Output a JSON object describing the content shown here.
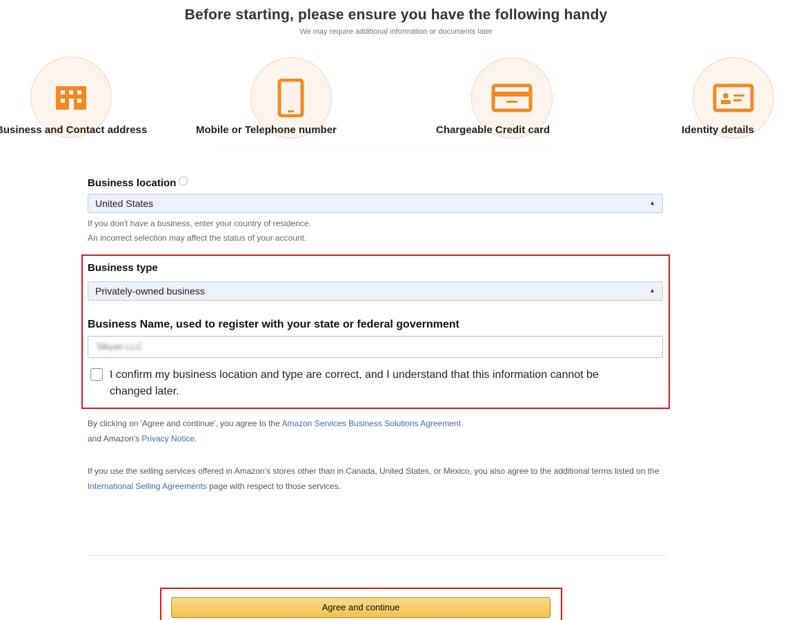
{
  "header": {
    "title": "Before starting, please ensure you have the following handy",
    "subtitle": "We may require additional information or documents later"
  },
  "requirements": [
    {
      "label": "Business and Contact address",
      "icon": "building-icon"
    },
    {
      "label": "Mobile or Telephone number",
      "icon": "mobile-phone-icon"
    },
    {
      "label": "Chargeable Credit card",
      "icon": "credit-card-icon"
    },
    {
      "label": "Identity details",
      "icon": "id-card-icon"
    }
  ],
  "form": {
    "business_location": {
      "label": "Business location",
      "value": "United States",
      "help": [
        "If you don't have a business, enter your country of residence.",
        "An incorrect selection may affect the status of your account."
      ]
    },
    "business_type": {
      "label": "Business type",
      "value": "Privately-owned business"
    },
    "business_name": {
      "label": "Business Name, used to register with your state or federal government",
      "value": "Sikyan LLC"
    },
    "confirm": {
      "label": "I confirm my business location and type are correct, and I understand that this information cannot be changed later.",
      "checked": false
    }
  },
  "legal": {
    "p1_text1": "By clicking on 'Agree and continue', you agree to the ",
    "p1_link1": "Amazon Services Business Solutions Agreement",
    "p1_text2": " and Amazon's ",
    "p1_link2": "Privacy Notice",
    "p1_text3": ".",
    "p2_text1": "If you use the selling services offered in Amazon's stores other than in Canada, United States, or Mexico, you also agree to the additional terms listed on the ",
    "p2_link1": "International Selling Agreements",
    "p2_text2": " page with respect to those services."
  },
  "actions": {
    "continue_label": "Agree and continue"
  },
  "colors": {
    "icon_accent": "#f08a24",
    "highlight": "#e0161b",
    "link": "#3a6cb0",
    "button": "#f1c14d"
  }
}
